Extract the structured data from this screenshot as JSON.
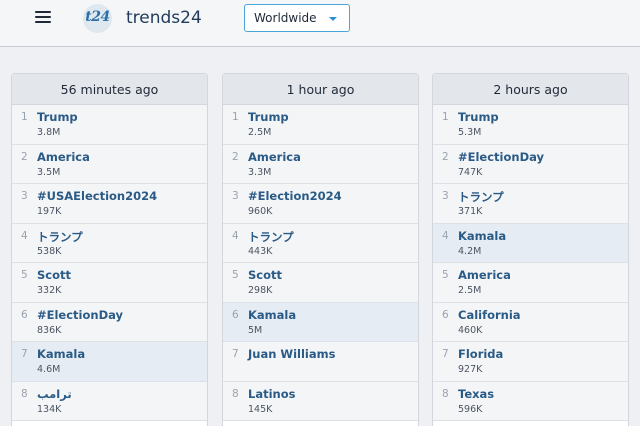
{
  "header": {
    "logo_text": "t24",
    "site_name": "trends24",
    "region": "Worldwide"
  },
  "columns": [
    {
      "time": "56 minutes ago",
      "trends": [
        {
          "rank": "1",
          "name": "Trump",
          "count": "3.8M"
        },
        {
          "rank": "2",
          "name": "America",
          "count": "3.5M"
        },
        {
          "rank": "3",
          "name": "#USAElection2024",
          "count": "197K"
        },
        {
          "rank": "4",
          "name": "トランプ",
          "count": "538K"
        },
        {
          "rank": "5",
          "name": "Scott",
          "count": "332K"
        },
        {
          "rank": "6",
          "name": "#ElectionDay",
          "count": "836K"
        },
        {
          "rank": "7",
          "name": "Kamala",
          "count": "4.6M"
        },
        {
          "rank": "8",
          "name": "ترامب",
          "count": "134K"
        }
      ]
    },
    {
      "time": "1 hour ago",
      "trends": [
        {
          "rank": "1",
          "name": "Trump",
          "count": "2.5M"
        },
        {
          "rank": "2",
          "name": "America",
          "count": "3.3M"
        },
        {
          "rank": "3",
          "name": "#Election2024",
          "count": "960K"
        },
        {
          "rank": "4",
          "name": "トランプ",
          "count": "443K"
        },
        {
          "rank": "5",
          "name": "Scott",
          "count": "298K"
        },
        {
          "rank": "6",
          "name": "Kamala",
          "count": "5M"
        },
        {
          "rank": "7",
          "name": "Juan Williams",
          "count": ""
        },
        {
          "rank": "8",
          "name": "Latinos",
          "count": "145K"
        }
      ]
    },
    {
      "time": "2 hours ago",
      "trends": [
        {
          "rank": "1",
          "name": "Trump",
          "count": "5.3M"
        },
        {
          "rank": "2",
          "name": "#ElectionDay",
          "count": "747K"
        },
        {
          "rank": "3",
          "name": "トランプ",
          "count": "371K"
        },
        {
          "rank": "4",
          "name": "Kamala",
          "count": "4.2M"
        },
        {
          "rank": "5",
          "name": "America",
          "count": "2.5M"
        },
        {
          "rank": "6",
          "name": "California",
          "count": "460K"
        },
        {
          "rank": "7",
          "name": "Florida",
          "count": "927K"
        },
        {
          "rank": "8",
          "name": "Texas",
          "count": "596K"
        }
      ]
    }
  ]
}
